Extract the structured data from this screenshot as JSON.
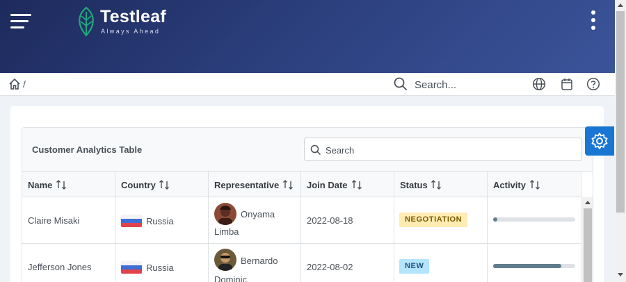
{
  "brand": {
    "name": "Testleaf",
    "tagline": "Always Ahead",
    "accent": "#20a87a"
  },
  "header": {
    "gradient_start": "#1d2a5c",
    "gradient_end": "#3b5499"
  },
  "breadcrumb": {
    "home_icon": "home-icon",
    "separator": "/"
  },
  "topbar": {
    "search_placeholder": "Search...",
    "icons": [
      "globe-icon",
      "calendar-icon",
      "help-icon"
    ]
  },
  "table": {
    "title": "Customer Analytics Table",
    "search_placeholder": "Search",
    "columns": [
      "Name",
      "Country",
      "Representative",
      "Join Date",
      "Status",
      "Activity"
    ],
    "rows": [
      {
        "name": "Claire Misaki",
        "country": "Russia",
        "rep_first": "Onyama",
        "rep_last": "Limba",
        "date": "2022-08-18",
        "status": "NEGOTIATION",
        "status_bg": "#ffd8b2",
        "status_fg": "#805b36",
        "activity": 0.05
      },
      {
        "name": "Jefferson Jones",
        "country": "Russia",
        "rep_first": "Bernardo",
        "rep_last": "Dominic",
        "date": "2022-08-02",
        "status": "NEW",
        "status_bg": "#b3e5fc",
        "status_fg": "#23547b",
        "activity": 0.83
      }
    ]
  },
  "config_button": {
    "icon": "gear-icon",
    "color": "#1976d2"
  }
}
